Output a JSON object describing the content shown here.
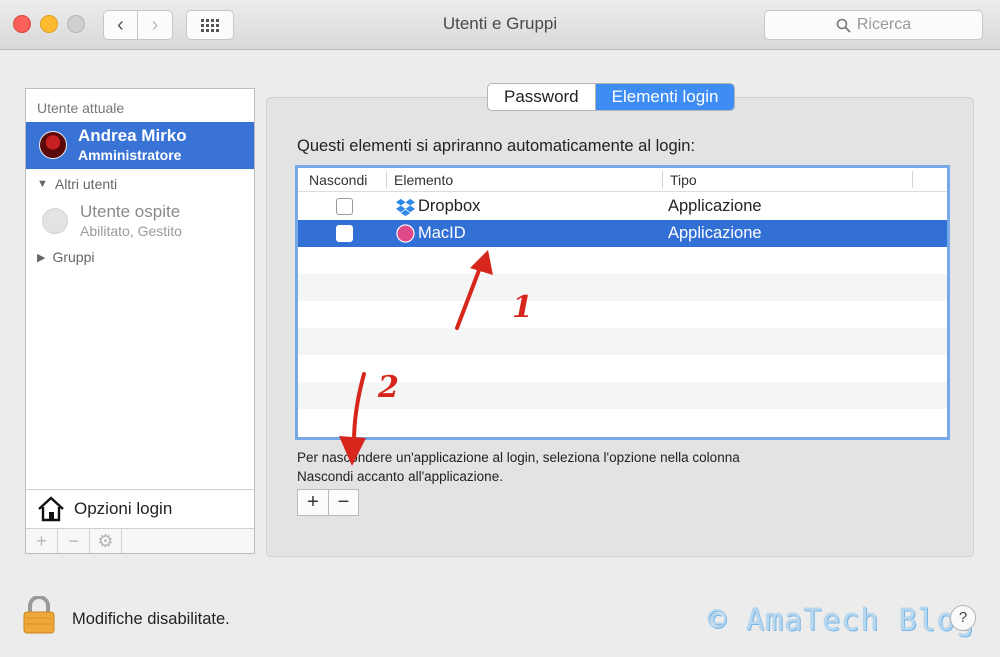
{
  "window": {
    "title": "Utenti e Gruppi",
    "search_placeholder": "Ricerca"
  },
  "sidebar": {
    "header": "Utente attuale",
    "current_user": {
      "name": "Andrea Mirko",
      "role": "Amministratore"
    },
    "other_users_label": "Altri utenti",
    "guest": {
      "name": "Utente ospite",
      "status": "Abilitato, Gestito"
    },
    "groups_label": "Gruppi",
    "login_options_label": "Opzioni login"
  },
  "tabs": [
    {
      "label": "Password",
      "active": false
    },
    {
      "label": "Elementi login",
      "active": true
    }
  ],
  "main": {
    "intro": "Questi elementi si apriranno automaticamente al login:",
    "help_line1": "Per nascondere un'applicazione al login, seleziona l'opzione nella colonna",
    "help_line2": "Nascondi accanto all'applicazione."
  },
  "table": {
    "columns": [
      "Nascondi",
      "Elemento",
      "Tipo"
    ],
    "rows": [
      {
        "hide": false,
        "name": "Dropbox",
        "type": "Applicazione",
        "icon": "dropbox-icon",
        "selected": false
      },
      {
        "hide": false,
        "name": "MacID",
        "type": "Applicazione",
        "icon": "macid-icon",
        "selected": true
      }
    ]
  },
  "buttons": {
    "add": "+",
    "remove": "−"
  },
  "footer": {
    "lock_label": "Modifiche disabilitate.",
    "help": "?"
  },
  "watermark": "© AmaTech Blog",
  "annotations": {
    "arrow1": "1",
    "arrow2": "2"
  },
  "colors": {
    "selection": "#3370d6",
    "tab_active": "#3d8df5",
    "annotation": "#d7261c"
  }
}
